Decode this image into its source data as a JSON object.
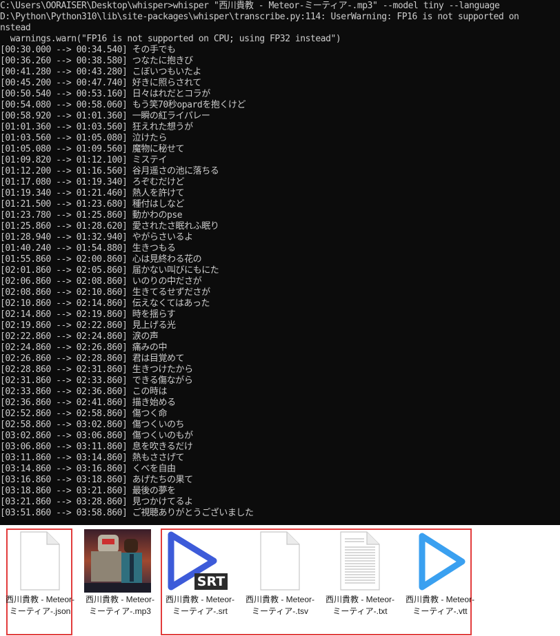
{
  "terminal": {
    "lines": [
      "C:\\Users\\OORAISER\\Desktop\\whisper>whisper \"西川貴教 - Meteor-ミーティア-.mp3\" --model tiny --language",
      "D:\\Python\\Python310\\lib\\site-packages\\whisper\\transcribe.py:114: UserWarning: FP16 is not supported on",
      "nstead",
      "  warnings.warn(\"FP16 is not supported on CPU; using FP32 instead\")",
      "[00:30.000 --> 00:34.540] その手でも",
      "[00:36.260 --> 00:38.580] つなたに抱きび",
      "[00:41.280 --> 00:43.280] こぼいつもいたよ",
      "[00:45.200 --> 00:47.740] 好きに照らされて",
      "[00:50.540 --> 00:53.160] 日々はれだとコラが",
      "[00:54.080 --> 00:58.060] もう笑70秒opardを抱くけど",
      "[00:58.920 --> 01:01.360] 一瞬の紅ライパレー",
      "[01:01.360 --> 01:03.560] 狂えれた想うが",
      "[01:03.560 --> 01:05.080] 泣けたら",
      "[01:05.080 --> 01:09.560] 魔物に秘せて",
      "[01:09.820 --> 01:12.100] ミステイ",
      "[01:12.200 --> 01:16.560] 谷月遥さの池に落ちる",
      "[01:17.080 --> 01:19.340] ろぞむだけど",
      "[01:19.340 --> 01:21.460] 熱人を許けて",
      "[01:21.500 --> 01:23.680] 種付はしなど",
      "[01:23.780 --> 01:25.860] 動かわのpse",
      "[01:25.860 --> 01:28.620] 愛されたさ眠れふ眠り",
      "[01:28.940 --> 01:32.940] やがらさいるよ",
      "[01:40.240 --> 01:54.880] 生きつもる",
      "[01:55.860 --> 02:00.860] 心は見終わる花の",
      "[02:01.860 --> 02:05.860] 届かない叫びにもにた",
      "[02:06.860 --> 02:08.860] いのりの中ださが",
      "[02:08.860 --> 02:10.860] 生きてるせずださが",
      "[02:10.860 --> 02:14.860] 伝えなくてはあった",
      "[02:14.860 --> 02:19.860] 時を揺らす",
      "[02:19.860 --> 02:22.860] 見上げる光",
      "[02:22.860 --> 02:24.860] 涙の声",
      "[02:24.860 --> 02:26.860] 痛みの中",
      "[02:26.860 --> 02:28.860] 君は目覚めて",
      "[02:28.860 --> 02:31.860] 生きつけたから",
      "[02:31.860 --> 02:33.860] できる傷ながら",
      "[02:33.860 --> 02:36.860] この時は",
      "[02:36.860 --> 02:41.860] 描き始める",
      "[02:52.860 --> 02:58.860] 傷つく命",
      "[02:58.860 --> 03:02.860] 傷つくいのち",
      "[03:02.860 --> 03:06.860] 傷つくいのもが",
      "[03:06.860 --> 03:11.860] 息を吹きるだけ",
      "[03:11.860 --> 03:14.860] 熱もささげて",
      "[03:14.860 --> 03:16.860] くべを自由",
      "[03:16.860 --> 03:18.860] あげたちの果て",
      "[03:18.860 --> 03:21.860] 最後の夢を",
      "[03:21.860 --> 03:28.860] 見つかけてるよ",
      "[03:51.860 --> 03:58.860] ご視聴ありがとうございました"
    ]
  },
  "files": [
    {
      "label": "西川貴教 - Meteor-ミーティア-.json",
      "icon": "blank-document-icon"
    },
    {
      "label": "西川貴教 - Meteor-ミーティア-.mp3",
      "icon": "album-art-thumbnail"
    },
    {
      "label": "西川貴教 - Meteor-ミーティア-.srt",
      "icon": "play-srt-icon",
      "badge": "SRT"
    },
    {
      "label": "西川貴教 - Meteor-ミーティア-.tsv",
      "icon": "blank-document-icon"
    },
    {
      "label": "西川貴教 - Meteor-ミーティア-.txt",
      "icon": "text-document-icon"
    },
    {
      "label": "西川貴教 - Meteor-ミーティア-.vtt",
      "icon": "play-icon"
    }
  ],
  "colors": {
    "terminal_bg": "#0c0c0c",
    "terminal_text": "#cccccc",
    "selection_border": "#e23b3b",
    "play_blue_dark": "#3d5bd9",
    "play_blue_light": "#3aa0f0"
  }
}
